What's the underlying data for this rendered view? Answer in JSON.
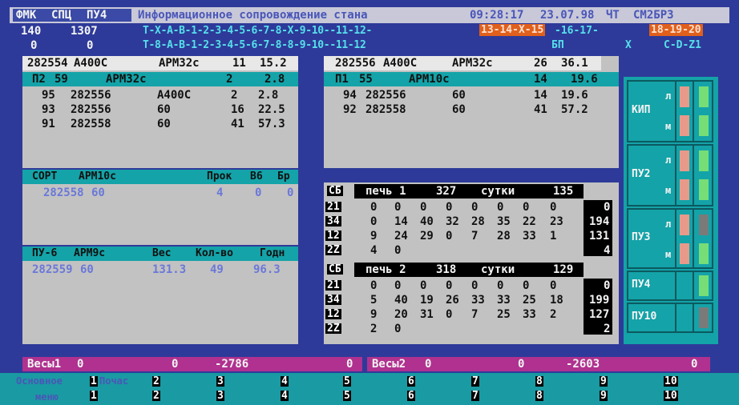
{
  "header": {
    "menu": [
      "ФМК",
      "СПЦ",
      "ПУ4"
    ],
    "title": "Информационное сопровождение стана",
    "time": "09:28:17",
    "date": "23.07.98",
    "day": "ЧТ",
    "mode": "СМ2БР3"
  },
  "row2": {
    "a": "140",
    "b": "1307",
    "seq_white": "T-X-A-B-1-2-3-4-5-6-7-8-X-9-10--11-12-",
    "seq_red1": "13-14-X-15",
    "seq_white2": "-16-17-",
    "seq_red2": "18-19-20"
  },
  "row3": {
    "a": "0",
    "b": "0",
    "seq": "T-8-A-B-1-2-3-4-5-6-7-8-8-9-10--11-12",
    "bp": "БП",
    "x": "X",
    "cd": "C-D-Z1"
  },
  "left_top": {
    "strip": [
      "282554",
      "А400С",
      "АРМ32с",
      "11",
      "15.2"
    ],
    "header": [
      "П2",
      "59",
      "АРМ32с",
      "2",
      "2.8"
    ],
    "rows": [
      [
        "95",
        "282556",
        "А400С",
        "2",
        "2.8"
      ],
      [
        "93",
        "282556",
        "60",
        "16",
        "22.5"
      ],
      [
        "91",
        "282558",
        "60",
        "41",
        "57.3"
      ]
    ]
  },
  "right_top": {
    "strip": [
      "282556",
      "А400С",
      "АРМ32с",
      "26",
      "36.1"
    ],
    "header": [
      "П1",
      "55",
      "АРМ10с",
      "14",
      "19.6"
    ],
    "rows": [
      [
        "94",
        "282556",
        "60",
        "14",
        "19.6"
      ],
      [
        "92",
        "282558",
        "60",
        "41",
        "57.2"
      ]
    ]
  },
  "sort_panel": {
    "headers": [
      "СОРТ",
      "АРМ10с",
      "Прок",
      "В6",
      "Бр"
    ],
    "row": [
      "282558",
      "60",
      "4",
      "0",
      "0"
    ]
  },
  "pu6_panel": {
    "headers": [
      "ПУ-6",
      "АРМ9с",
      "Вес",
      "Кол-во",
      "Годн"
    ],
    "row": [
      "282559",
      "60",
      "131.3",
      "49",
      "96.3"
    ]
  },
  "furnaces": [
    {
      "title": "печь 1",
      "value": "327",
      "label": "сутки",
      "total": "135",
      "rows": [
        {
          "code": "21",
          "vals": [
            "0",
            "0",
            "0",
            "0",
            "0",
            "0",
            "0",
            "0"
          ],
          "sum": "0"
        },
        {
          "code": "34",
          "vals": [
            "0",
            "14",
            "40",
            "32",
            "28",
            "35",
            "22",
            "23"
          ],
          "sum": "194"
        },
        {
          "code": "12",
          "vals": [
            "9",
            "24",
            "29",
            "0",
            "7",
            "28",
            "33",
            "1"
          ],
          "sum": "131"
        },
        {
          "code": "2Z",
          "vals": [
            "4",
            "0",
            "",
            "",
            "",
            "",
            "",
            ""
          ],
          "sum": "4"
        }
      ]
    },
    {
      "title": "печь 2",
      "value": "318",
      "label": "сутки",
      "total": "129",
      "rows": [
        {
          "code": "21",
          "vals": [
            "0",
            "0",
            "0",
            "0",
            "0",
            "0",
            "0",
            "0"
          ],
          "sum": "0"
        },
        {
          "code": "34",
          "vals": [
            "5",
            "40",
            "19",
            "26",
            "33",
            "33",
            "25",
            "18"
          ],
          "sum": "199"
        },
        {
          "code": "12",
          "vals": [
            "9",
            "20",
            "31",
            "0",
            "7",
            "25",
            "33",
            "2"
          ],
          "sum": "127"
        },
        {
          "code": "2Z",
          "vals": [
            "2",
            "0",
            "",
            "",
            "",
            "",
            "",
            ""
          ],
          "sum": "2"
        }
      ]
    }
  ],
  "side_panel": {
    "groups": [
      {
        "label": "КИП",
        "l": "л",
        "m": "м"
      },
      {
        "label": "ПУ2",
        "l": "л",
        "m": "м"
      },
      {
        "label": "ПУ3",
        "l": "л",
        "m": "м"
      },
      {
        "label": "ПУ4"
      },
      {
        "label": "ПУ10"
      }
    ]
  },
  "scales": [
    {
      "label": "Весы1",
      "a": "0",
      "b": "0",
      "c": "-2786",
      "d": "0"
    },
    {
      "label": "Весы2",
      "a": "0",
      "b": "0",
      "c": "-2603",
      "d": "0"
    }
  ],
  "fkeys": {
    "left_top": "Основное",
    "left_bottom": "меню",
    "poc": "Почас",
    "numbers": [
      "1",
      "2",
      "3",
      "4",
      "5",
      "6",
      "7",
      "8",
      "9",
      "10"
    ]
  },
  "colors": {
    "background": "#2e3a99",
    "panel": "#c2c2c2",
    "teal": "#14a3a8",
    "magenta": "#b0318f",
    "highlight": "#e0601c",
    "indicator_red": "#e89a8a",
    "indicator_green": "#77dd77",
    "indicator_gray": "#7a7a7a"
  }
}
